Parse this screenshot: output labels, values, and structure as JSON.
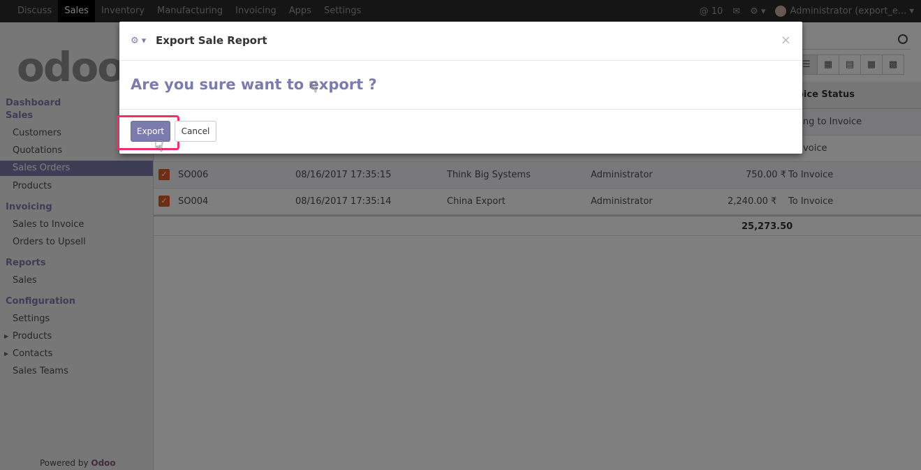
{
  "navbar": {
    "menu": [
      "Discuss",
      "Sales",
      "Inventory",
      "Manufacturing",
      "Invoicing",
      "Apps",
      "Settings"
    ],
    "active": "Sales",
    "mentions": "@ 10",
    "user": "Administrator (export_e..."
  },
  "sidebar": {
    "logo": "odoo",
    "sections": [
      {
        "label": "Dashboard"
      },
      {
        "label": "Sales",
        "items": [
          "Customers",
          "Quotations",
          "Sales Orders",
          "Products"
        ]
      },
      {
        "label": "Invoicing",
        "items": [
          "Sales to Invoice",
          "Orders to Upsell"
        ]
      },
      {
        "label": "Reports",
        "items": [
          "Sales"
        ]
      },
      {
        "label": "Configuration",
        "items": [
          "Settings",
          "Products",
          "Contacts",
          "Sales Teams"
        ]
      }
    ],
    "active_item": "Sales Orders",
    "powered_prefix": "Powered by",
    "powered_brand": "Odoo"
  },
  "list": {
    "header_status": "oice Status",
    "rows": [
      {
        "status": "hing to Invoice"
      },
      {
        "status": "Invoice"
      },
      {
        "order": "SO006",
        "date": "08/16/2017 17:35:15",
        "customer": "Think Big Systems",
        "salesperson": "Administrator",
        "total": "750.00 ₹",
        "status": "To Invoice"
      },
      {
        "order": "SO004",
        "date": "08/16/2017 17:35:14",
        "customer": "China Export",
        "salesperson": "Administrator",
        "total": "2,240.00 ₹",
        "status": "To Invoice"
      }
    ],
    "grand_total": "25,273.50"
  },
  "modal": {
    "title": "Export Sale Report",
    "question": "Are you sure want to export ?",
    "export_label": "Export",
    "cancel_label": "Cancel",
    "close_glyph": "×"
  },
  "colors": {
    "accent": "#7c7bad",
    "brand": "#875a7b",
    "highlight": "#f0306a"
  }
}
